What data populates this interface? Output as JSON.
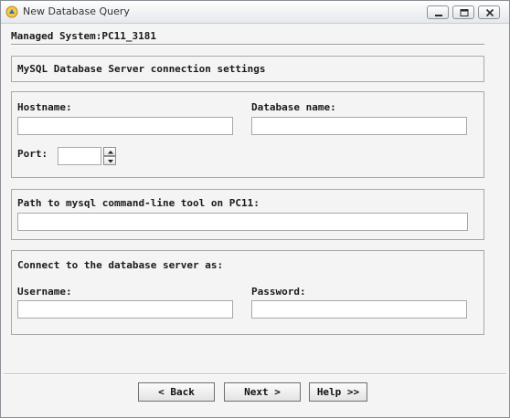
{
  "window": {
    "title": "New Database Query",
    "app_icon": "app-icon",
    "controls": {
      "minimize": "minimize-icon",
      "maximize": "maximize-icon",
      "close": "close-icon"
    }
  },
  "header": {
    "managed_system": "Managed System:PC11_3181"
  },
  "section_title": "MySQL Database Server connection settings",
  "connection": {
    "hostname_label": "Hostname:",
    "hostname_value": "",
    "database_label": "Database name:",
    "database_value": "",
    "port_label": "Port:",
    "port_value": ""
  },
  "path": {
    "label": "Path to mysql command-line tool on PC11:",
    "value": ""
  },
  "credentials": {
    "heading": "Connect to the database server as:",
    "username_label": "Username:",
    "username_value": "",
    "password_label": "Password:",
    "password_value": ""
  },
  "buttons": {
    "back": "< Back",
    "next": "Next >",
    "help": "Help >>"
  }
}
